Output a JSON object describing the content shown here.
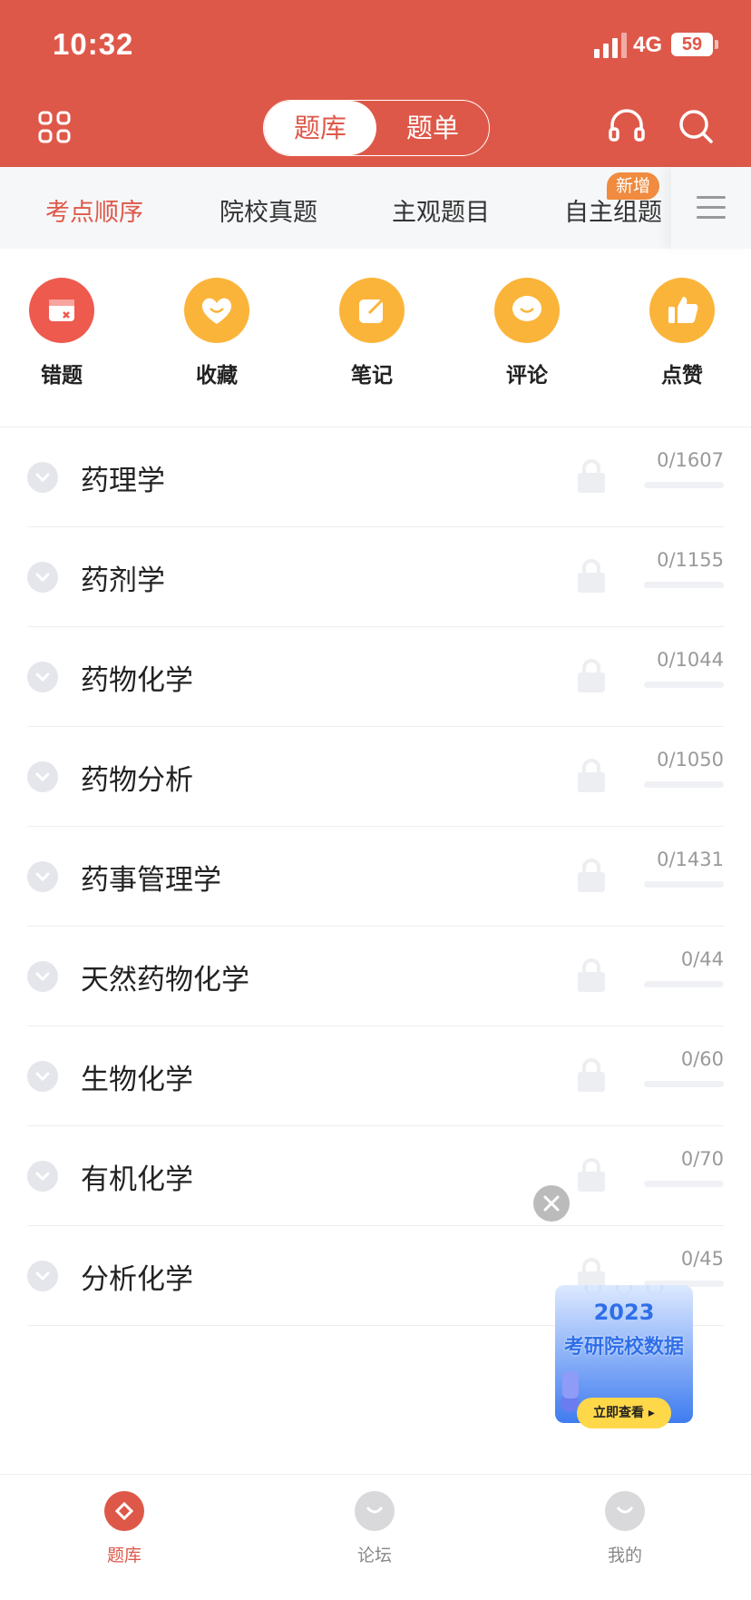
{
  "status_bar": {
    "time": "10:32",
    "network": "4G",
    "battery": "59"
  },
  "header": {
    "tabs": [
      {
        "label": "题库",
        "active": true
      },
      {
        "label": "题单",
        "active": false
      }
    ],
    "left_icon": "grid-menu-icon",
    "right_icons": [
      "headphones-icon",
      "search-icon"
    ]
  },
  "category_tabs": [
    {
      "label": "考点顺序",
      "active": true
    },
    {
      "label": "院校真题"
    },
    {
      "label": "主观题目"
    },
    {
      "label": "自主组题",
      "badge": "新增"
    }
  ],
  "shortcuts": [
    {
      "label": "错题",
      "icon": "wrong-questions-icon",
      "color": "#EE5A4E"
    },
    {
      "label": "收藏",
      "icon": "heart-icon",
      "color": "#FBB43A"
    },
    {
      "label": "笔记",
      "icon": "note-icon",
      "color": "#FBB43A"
    },
    {
      "label": "评论",
      "icon": "comment-icon",
      "color": "#FBB43A"
    },
    {
      "label": "点赞",
      "icon": "thumbs-up-icon",
      "color": "#FBB43A"
    }
  ],
  "subjects": [
    {
      "name": "药理学",
      "count": "0/1607",
      "progress": 0
    },
    {
      "name": "药剂学",
      "count": "0/1155",
      "progress": 0
    },
    {
      "name": "药物化学",
      "count": "0/1044",
      "progress": 0
    },
    {
      "name": "药物分析",
      "count": "0/1050",
      "progress": 0
    },
    {
      "name": "药事管理学",
      "count": "0/1431",
      "progress": 0
    },
    {
      "name": "天然药物化学",
      "count": "0/44",
      "progress": 0
    },
    {
      "name": "生物化学",
      "count": "0/60",
      "progress": 0
    },
    {
      "name": "有机化学",
      "count": "0/70",
      "progress": 0
    },
    {
      "name": "分析化学",
      "count": "0/45",
      "progress": 0
    }
  ],
  "ad": {
    "year": "2023",
    "title": "考研院校数据",
    "button": "立即查看 ▸"
  },
  "bottom_nav": [
    {
      "label": "题库",
      "active": true
    },
    {
      "label": "论坛"
    },
    {
      "label": "我的"
    }
  ],
  "colors": {
    "primary": "#DE5849",
    "accent": "#FBB43A"
  }
}
